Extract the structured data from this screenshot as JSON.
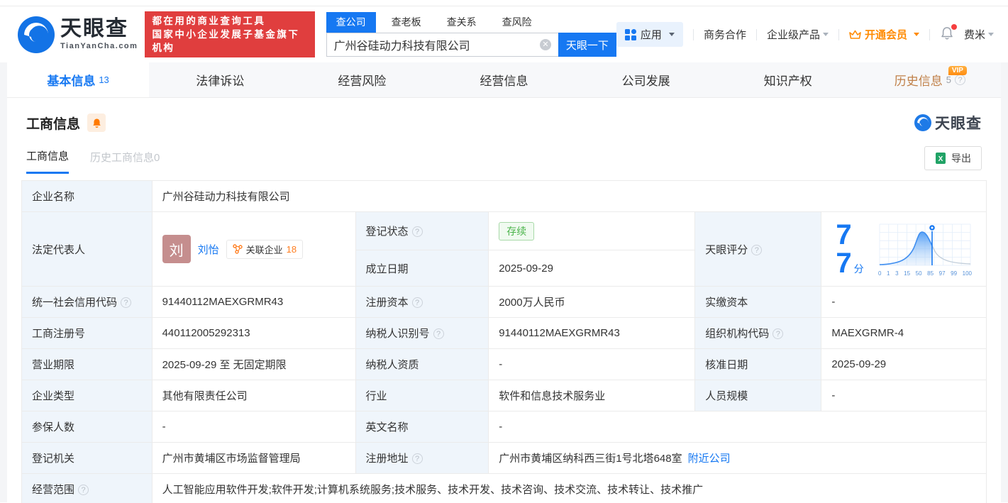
{
  "brand": {
    "name": "天眼查",
    "domain": "TianYanCha.com",
    "accent_blue": "#1678f2",
    "banner_red": "#e03e3e",
    "vip_orange": "#ff8a00"
  },
  "header": {
    "slogan_line1": "都在用的商业查询工具",
    "slogan_line2": "国家中小企业发展子基金旗下机构",
    "search": {
      "tabs": [
        "查公司",
        "查老板",
        "查关系",
        "查风险"
      ],
      "active_tab": "查公司",
      "value": "广州谷硅动力科技有限公司",
      "button": "天眼一下"
    },
    "nav": {
      "apps": "应用",
      "cooperation": "商务合作",
      "enterprise": "企业级产品",
      "vip": "开通会员",
      "username": "费米"
    }
  },
  "page_tabs": [
    {
      "label": "基本信息",
      "count": "13",
      "active": true
    },
    {
      "label": "法律诉讼"
    },
    {
      "label": "经营风险"
    },
    {
      "label": "经营信息"
    },
    {
      "label": "公司发展"
    },
    {
      "label": "知识产权"
    },
    {
      "label": "历史信息",
      "count": "5",
      "vip_badge": "VIP"
    }
  ],
  "section": {
    "title": "工商信息",
    "subtab_active": "工商信息",
    "subtab_history": "历史工商信息0",
    "export_label": "导出",
    "watermark": "天眼查"
  },
  "fields": {
    "company_name": {
      "label": "企业名称",
      "value": "广州谷硅动力科技有限公司"
    },
    "legal_rep": {
      "label": "法定代表人",
      "avatar_char": "刘",
      "name": "刘怡",
      "related_label": "关联企业",
      "related_count": "18"
    },
    "reg_status": {
      "label": "登记状态",
      "value": "存续"
    },
    "establish_date": {
      "label": "成立日期",
      "value": "2025-09-29"
    },
    "score": {
      "label": "天眼评分",
      "value": "77",
      "unit": "分"
    },
    "credit_code": {
      "label": "统一社会信用代码",
      "value": "91440112MAEXGRMR43"
    },
    "reg_capital": {
      "label": "注册资本",
      "value": "2000万人民币"
    },
    "paid_capital": {
      "label": "实缴资本",
      "value": "-"
    },
    "reg_number": {
      "label": "工商注册号",
      "value": "440112005292313"
    },
    "taxpayer_id": {
      "label": "纳税人识别号",
      "value": "91440112MAEXGRMR43"
    },
    "org_code": {
      "label": "组织机构代码",
      "value": "MAEXGRMR-4"
    },
    "business_term": {
      "label": "营业期限",
      "value": "2025-09-29 至 无固定期限"
    },
    "taxpayer_qualification": {
      "label": "纳税人资质",
      "value": "-"
    },
    "approval_date": {
      "label": "核准日期",
      "value": "2025-09-29"
    },
    "company_type": {
      "label": "企业类型",
      "value": "其他有限责任公司"
    },
    "industry": {
      "label": "行业",
      "value": "软件和信息技术服务业"
    },
    "staff_size": {
      "label": "人员规模",
      "value": "-"
    },
    "insured_count": {
      "label": "参保人数",
      "value": "-"
    },
    "english_name": {
      "label": "英文名称",
      "value": "-"
    },
    "reg_authority": {
      "label": "登记机关",
      "value": "广州市黄埔区市场监督管理局"
    },
    "reg_address": {
      "label": "注册地址",
      "value": "广州市黄埔区纳科西三街1号北塔648室",
      "nearby_link": "附近公司"
    },
    "business_scope": {
      "label": "经营范围",
      "value": "人工智能应用软件开发;软件开发;计算机系统服务;技术服务、技术开发、技术咨询、技术交流、技术转让、技术推广"
    }
  },
  "chart_data": {
    "type": "area",
    "title": "天眼评分分布曲线",
    "score": 77,
    "score_unit": "分",
    "x_ticks": [
      "0",
      "1",
      "3",
      "15",
      "50",
      "85",
      "97",
      "99",
      "100"
    ],
    "marker_value": 77,
    "relative_heights_at_ticks": [
      2,
      4,
      10,
      30,
      95,
      35,
      10,
      5,
      2
    ],
    "fill_color": "#4d9bf5",
    "line_color": "#3f8ef0",
    "tail_color": "#c3cfdb",
    "grid": true,
    "legend": false
  }
}
